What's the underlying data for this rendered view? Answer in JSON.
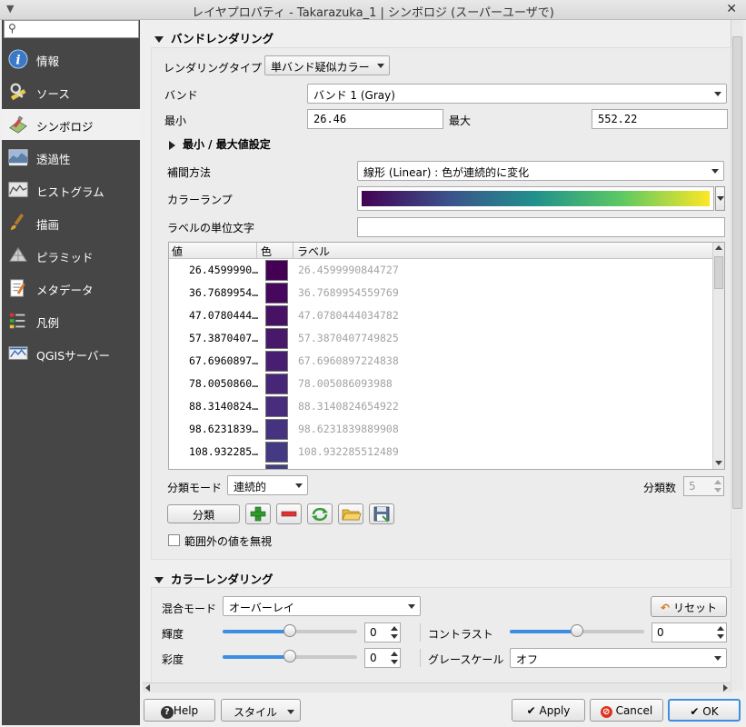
{
  "window": {
    "title": "レイヤプロパティ - Takarazuka_1 | シンボロジ (スーパーユーザで)",
    "menu_icon": "chevron-down-icon",
    "close_icon": "close-icon"
  },
  "sidebar": {
    "search_placeholder": "",
    "items": [
      {
        "label": "情報",
        "icon": "info-icon",
        "selected": false
      },
      {
        "label": "ソース",
        "icon": "source-icon",
        "selected": false
      },
      {
        "label": "シンボロジ",
        "icon": "symbology-icon",
        "selected": true
      },
      {
        "label": "透過性",
        "icon": "transparency-icon",
        "selected": false
      },
      {
        "label": "ヒストグラム",
        "icon": "histogram-icon",
        "selected": false
      },
      {
        "label": "描画",
        "icon": "rendering-brush-icon",
        "selected": false
      },
      {
        "label": "ピラミッド",
        "icon": "pyramid-icon",
        "selected": false
      },
      {
        "label": "メタデータ",
        "icon": "metadata-icon",
        "selected": false
      },
      {
        "label": "凡例",
        "icon": "legend-icon",
        "selected": false
      },
      {
        "label": "QGISサーバー",
        "icon": "qgis-server-icon",
        "selected": false
      }
    ]
  },
  "band_rendering": {
    "section_title": "バンドレンダリング",
    "render_type_label": "レンダリングタイプ",
    "render_type_value": "単バンド疑似カラー",
    "band_label": "バンド",
    "band_value": "バンド 1 (Gray)",
    "min_label": "最小",
    "min_value": "26.46",
    "max_label": "最大",
    "max_value": "552.22",
    "minmax_settings_label": "最小 / 最大値設定",
    "interpolation_label": "補間方法",
    "interpolation_value": "線形 (Linear) : 色が連続的に変化",
    "color_ramp_label": "カラーランプ",
    "color_ramp_stops": [
      "#440154",
      "#3b528b",
      "#21918c",
      "#5ec962",
      "#fde725"
    ],
    "label_unit_label": "ラベルの単位文字",
    "label_unit_value": "",
    "table": {
      "headers": [
        "値",
        "色",
        "ラベル"
      ],
      "rows": [
        {
          "value": "26.4599990…",
          "color": "#440154",
          "label": "26.4599990844727"
        },
        {
          "value": "36.7689954…",
          "color": "#46085c",
          "label": "36.7689954559769"
        },
        {
          "value": "47.0780444…",
          "color": "#471164",
          "label": "47.0780444034782"
        },
        {
          "value": "57.3870407…",
          "color": "#48186a",
          "label": "57.3870407749825"
        },
        {
          "value": "67.6960897…",
          "color": "#481f70",
          "label": "67.6960897224838"
        },
        {
          "value": "78.0050860…",
          "color": "#482677",
          "label": "78.005086093988"
        },
        {
          "value": "88.3140824…",
          "color": "#472d7b",
          "label": "88.3140824654922"
        },
        {
          "value": "98.6231839…",
          "color": "#46337f",
          "label": "98.6231839889908"
        },
        {
          "value": "108.932285…",
          "color": "#443a83",
          "label": "108.932285512489"
        }
      ]
    },
    "mode_label": "分類モード",
    "mode_value": "連続的",
    "classes_label": "分類数",
    "classes_value": "5",
    "classify_button": "分類",
    "tool_icons": [
      "add-plus-icon",
      "remove-minus-icon",
      "refresh-arrows-icon",
      "open-folder-icon",
      "save-disk-icon"
    ],
    "clip_label": "範囲外の値を無視"
  },
  "color_rendering": {
    "section_title": "カラーレンダリング",
    "blend_label": "混合モード",
    "blend_value": "オーバーレイ",
    "reset_button": "リセット",
    "brightness_label": "輝度",
    "brightness_value": "0",
    "brightness_level": 0.5,
    "contrast_label": "コントラスト",
    "contrast_value": "0",
    "contrast_level": 0.5,
    "saturation_label": "彩度",
    "saturation_value": "0",
    "saturation_level": 0.5,
    "grayscale_label": "グレースケール",
    "grayscale_value": "オフ"
  },
  "footer": {
    "help_button": "Help",
    "style_button": "スタイル",
    "apply_button": "Apply",
    "cancel_button": "Cancel",
    "ok_button": "OK"
  }
}
